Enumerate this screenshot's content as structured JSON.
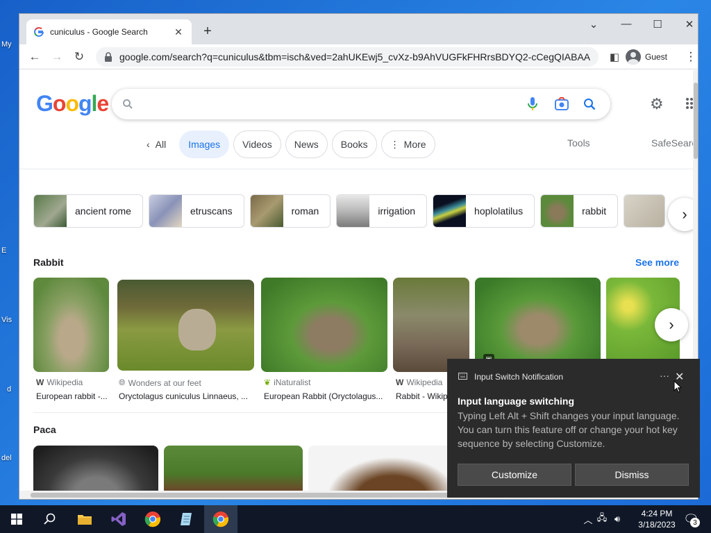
{
  "desktop": {
    "labels": [
      "My",
      "E",
      "Vis",
      "d",
      "del"
    ]
  },
  "browser": {
    "tab_title": "cuniculus - Google Search",
    "url": "google.com/search?q=cuniculus&tbm=isch&ved=2ahUKEwj5_cvXz-b9AhVUGFkFHRrsBDYQ2-cCegQIABAA...",
    "profile_label": "Guest"
  },
  "page": {
    "logo": [
      "G",
      "o",
      "o",
      "g",
      "l",
      "e"
    ],
    "search_value": "",
    "filters": {
      "all": "All",
      "images": "Images",
      "videos": "Videos",
      "news": "News",
      "books": "Books",
      "more": "More"
    },
    "tools": "Tools",
    "safesearch": "SafeSearch",
    "related": [
      "ancient rome",
      "etruscans",
      "roman",
      "irrigation",
      "hoplolatilus",
      "rabbit"
    ],
    "rabbit_section": {
      "title": "Rabbit",
      "see_more": "See more",
      "results": [
        {
          "source": "Wikipedia",
          "caption": "European rabbit -..."
        },
        {
          "source": "Wonders at our feet",
          "caption": "Oryctolagus cuniculus Linnaeus, ..."
        },
        {
          "source": "iNaturalist",
          "caption": "European Rabbit (Oryctolagus..."
        },
        {
          "source": "Wikipedia",
          "caption": "Rabbit - Wikip"
        }
      ]
    },
    "paca_section": {
      "title": "Paca"
    }
  },
  "notification": {
    "app": "Input Switch Notification",
    "more": "···",
    "title": "Input language switching",
    "body": "Typing Left Alt + Shift changes your input language. You can turn this feature off or change your hot key sequence by selecting Customize.",
    "customize": "Customize",
    "dismiss": "Dismiss"
  },
  "taskbar": {
    "time": "4:24 PM",
    "date": "3/18/2023",
    "notification_count": "3"
  },
  "colors": {
    "google_blue": "#4285f4",
    "google_red": "#ea4335",
    "google_yellow": "#fbbc05",
    "google_green": "#34a853",
    "link_blue": "#1a73e8",
    "toast_bg": "#2b2b2b",
    "taskbar_bg": "#101828"
  }
}
